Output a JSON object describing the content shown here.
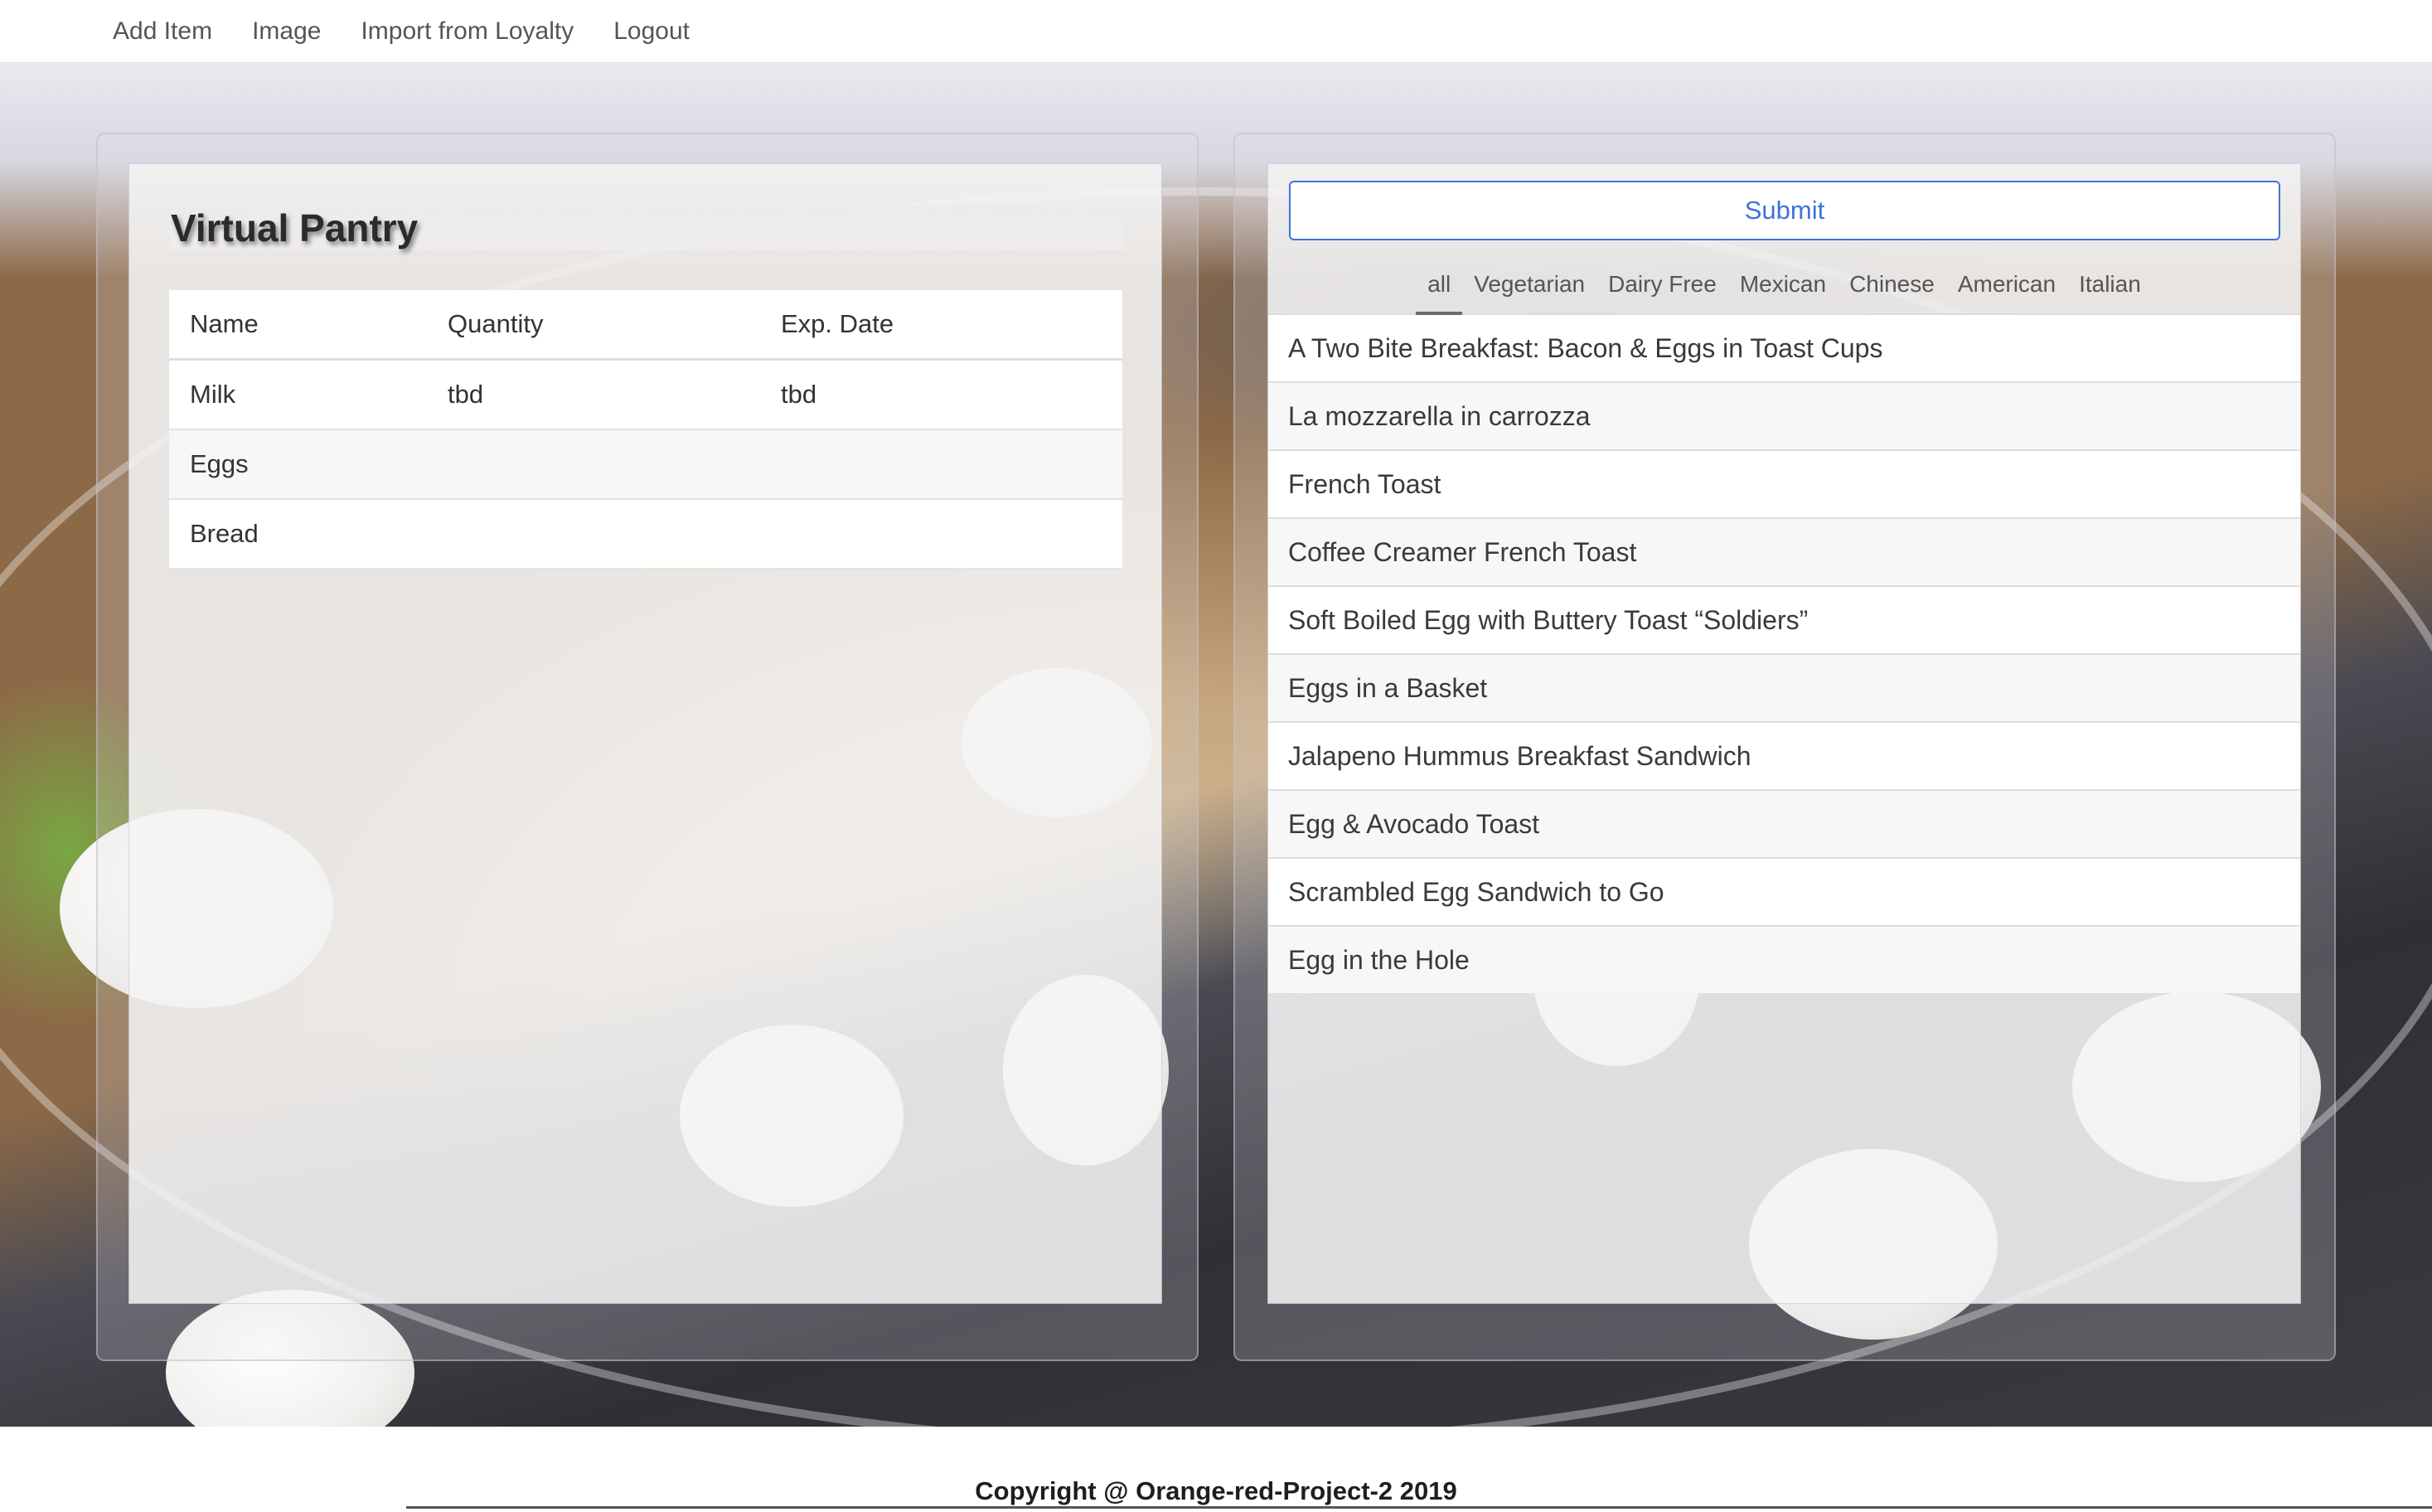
{
  "nav": {
    "items": [
      {
        "label": "Add Item"
      },
      {
        "label": "Image"
      },
      {
        "label": "Import from Loyalty"
      },
      {
        "label": "Logout"
      }
    ]
  },
  "pantry": {
    "title": "Virtual Pantry",
    "columns": [
      "Name",
      "Quantity",
      "Exp. Date"
    ],
    "rows": [
      {
        "name": "Milk",
        "quantity": "tbd",
        "exp_date": "tbd"
      },
      {
        "name": "Eggs",
        "quantity": "",
        "exp_date": ""
      },
      {
        "name": "Bread",
        "quantity": "",
        "exp_date": ""
      }
    ]
  },
  "recipes": {
    "submit_label": "Submit",
    "tabs": [
      {
        "label": "all",
        "active": true
      },
      {
        "label": "Vegetarian"
      },
      {
        "label": "Dairy Free"
      },
      {
        "label": "Mexican"
      },
      {
        "label": "Chinese"
      },
      {
        "label": "American"
      },
      {
        "label": "Italian"
      }
    ],
    "items": [
      "A Two Bite Breakfast: Bacon & Eggs in Toast Cups",
      "La mozzarella in carrozza",
      "French Toast",
      "Coffee Creamer French Toast",
      "Soft Boiled Egg with Buttery Toast “Soldiers”",
      "Eggs in a Basket",
      "Jalapeno Hummus Breakfast Sandwich",
      "Egg & Avocado Toast",
      "Scrambled Egg Sandwich to Go",
      "Egg in the Hole"
    ]
  },
  "footer": {
    "copyright": "Copyright @ Orange-red-Project-2 2019"
  }
}
